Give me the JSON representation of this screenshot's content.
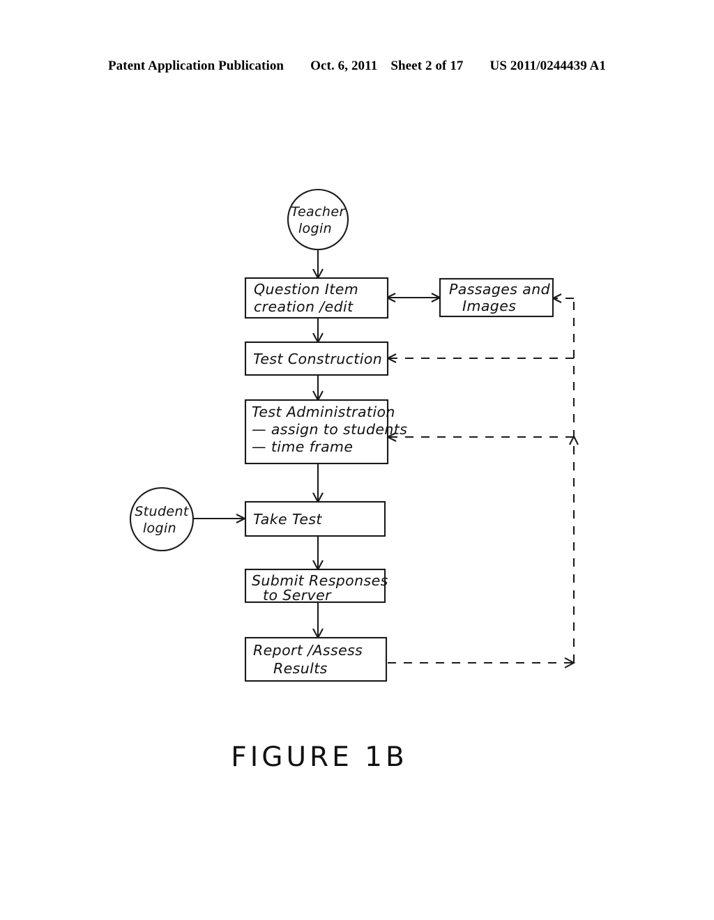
{
  "header": {
    "publication": "Patent Application Publication",
    "date": "Oct. 6, 2011",
    "sheet": "Sheet 2 of 17",
    "patent_number": "US 2011/0244439 A1"
  },
  "figure": {
    "caption": "FIGURE 1B",
    "nodes": {
      "teacher_login": {
        "line1": "Teacher",
        "line2": "login"
      },
      "student_login": {
        "line1": "Student",
        "line2": "login"
      },
      "question_item": {
        "line1": "Question Item",
        "line2": "creation /edit"
      },
      "passages_images": {
        "line1": "Passages and",
        "line2": "Images"
      },
      "test_construction": {
        "line1": "Test Construction"
      },
      "test_administration": {
        "line1": "Test Administration",
        "line2": "— assign to students",
        "line3": "— time frame"
      },
      "take_test": {
        "line1": "Take Test"
      },
      "submit_responses": {
        "line1": "Submit Responses",
        "line2": "to Server"
      },
      "report_assess": {
        "line1": "Report /Assess",
        "line2": "Results"
      }
    }
  },
  "chart_data": {
    "type": "diagram",
    "title": "FIGURE 1B",
    "nodes": [
      {
        "id": "teacher_login",
        "label": "Teacher login",
        "shape": "circle"
      },
      {
        "id": "question_item",
        "label": "Question Item creation /edit",
        "shape": "rect"
      },
      {
        "id": "passages_images",
        "label": "Passages and Images",
        "shape": "rect"
      },
      {
        "id": "test_construction",
        "label": "Test Construction",
        "shape": "rect"
      },
      {
        "id": "test_administration",
        "label": "Test Administration - assign to students - time frame",
        "shape": "rect"
      },
      {
        "id": "student_login",
        "label": "Student login",
        "shape": "circle"
      },
      {
        "id": "take_test",
        "label": "Take Test",
        "shape": "rect"
      },
      {
        "id": "submit_responses",
        "label": "Submit Responses to Server",
        "shape": "rect"
      },
      {
        "id": "report_assess",
        "label": "Report /Assess Results",
        "shape": "rect"
      }
    ],
    "edges": [
      {
        "from": "teacher_login",
        "to": "question_item",
        "style": "solid",
        "arrow": "single"
      },
      {
        "from": "question_item",
        "to": "passages_images",
        "style": "solid",
        "arrow": "double"
      },
      {
        "from": "question_item",
        "to": "test_construction",
        "style": "solid",
        "arrow": "single"
      },
      {
        "from": "test_construction",
        "to": "test_administration",
        "style": "solid",
        "arrow": "single"
      },
      {
        "from": "student_login",
        "to": "take_test",
        "style": "solid",
        "arrow": "single"
      },
      {
        "from": "test_administration",
        "to": "take_test",
        "style": "solid",
        "arrow": "single"
      },
      {
        "from": "take_test",
        "to": "submit_responses",
        "style": "solid",
        "arrow": "single"
      },
      {
        "from": "submit_responses",
        "to": "report_assess",
        "style": "solid",
        "arrow": "single"
      },
      {
        "from": "report_assess",
        "to": "feedback_bus",
        "style": "dashed",
        "arrow": "single"
      },
      {
        "from": "feedback_bus",
        "to": "passages_images",
        "style": "dashed",
        "arrow": "single"
      },
      {
        "from": "feedback_bus",
        "to": "test_construction",
        "style": "dashed",
        "arrow": "single"
      },
      {
        "from": "feedback_bus",
        "to": "test_administration",
        "style": "dashed",
        "arrow": "single"
      }
    ]
  }
}
